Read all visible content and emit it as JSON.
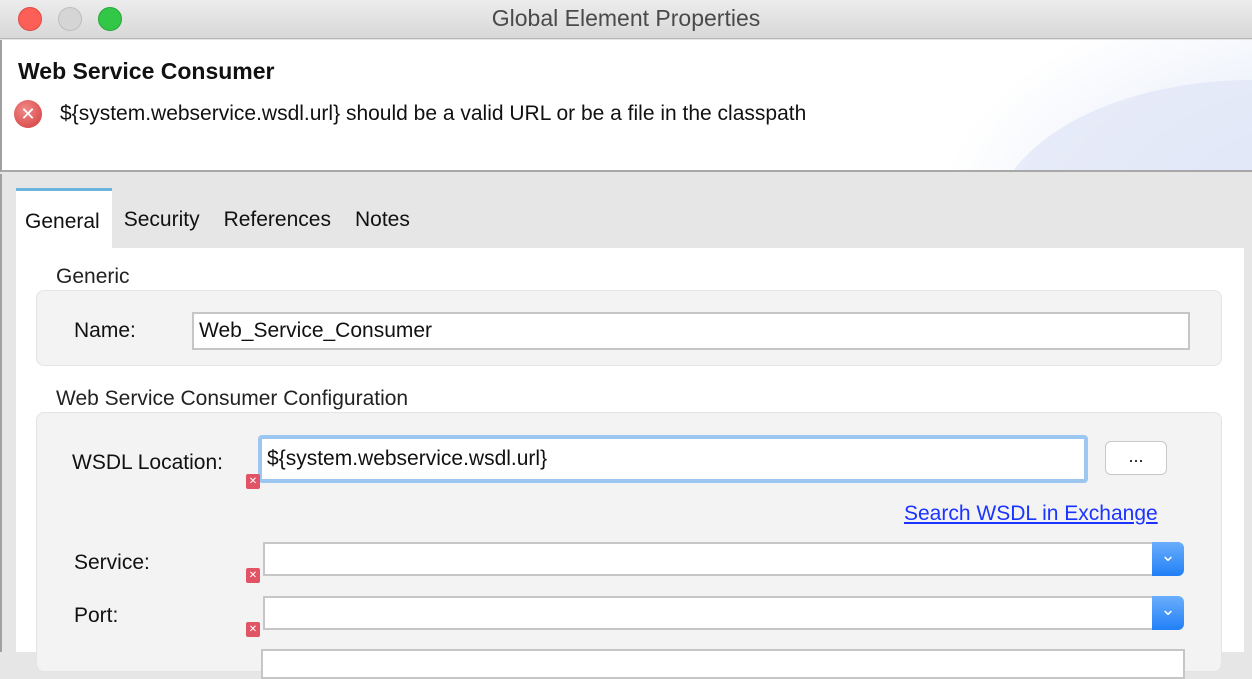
{
  "window": {
    "title": "Global Element Properties"
  },
  "header": {
    "title": "Web Service Consumer",
    "error_message": "${system.webservice.wsdl.url} should be a valid URL or be a file in the classpath"
  },
  "tabs": [
    {
      "label": "General",
      "active": true
    },
    {
      "label": "Security",
      "active": false
    },
    {
      "label": "References",
      "active": false
    },
    {
      "label": "Notes",
      "active": false
    }
  ],
  "generic": {
    "label": "Generic",
    "name_label": "Name:",
    "name_value": "Web_Service_Consumer"
  },
  "config": {
    "label": "Web Service Consumer Configuration",
    "wsdl_label": "WSDL Location:",
    "wsdl_value": "${system.webservice.wsdl.url}",
    "browse_label": "...",
    "search_link": "Search WSDL in Exchange",
    "service_label": "Service:",
    "service_value": "",
    "port_label": "Port:",
    "port_value": ""
  },
  "icons": {
    "error": "✕",
    "chevron": "⌄"
  },
  "colors": {
    "accent_tab": "#6cb4de",
    "focus_ring": "#9cc7f1",
    "link": "#1a33ff",
    "error": "#e05466",
    "select_button": "#2180f6"
  }
}
